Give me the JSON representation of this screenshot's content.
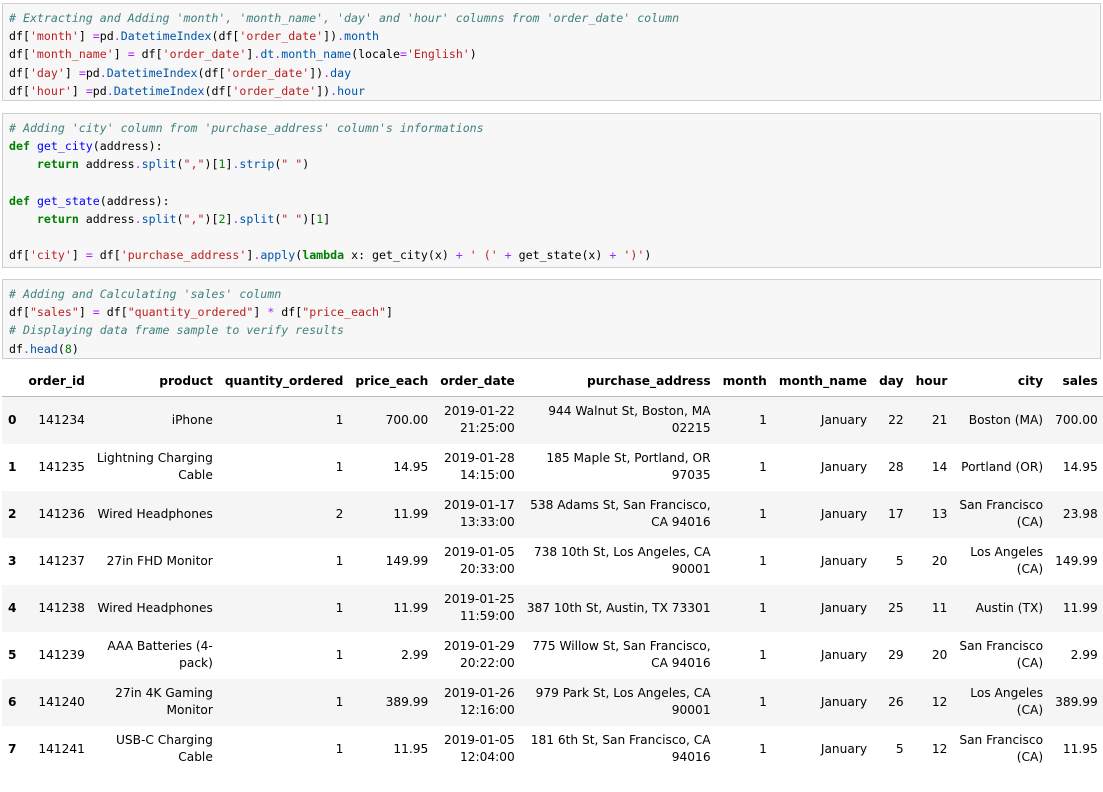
{
  "cells": [
    {
      "lines": [
        [
          [
            "cm",
            "# Extracting and Adding 'month', 'month_name', 'day' and 'hour' columns from 'order_date' column"
          ]
        ],
        [
          [
            "",
            "df["
          ],
          [
            "st",
            "'month'"
          ],
          [
            "",
            "] "
          ],
          [
            "op",
            "="
          ],
          [
            "",
            "pd"
          ],
          [
            "op",
            "."
          ],
          [
            "at",
            "DatetimeIndex"
          ],
          [
            "",
            "(df["
          ],
          [
            "st",
            "'order_date'"
          ],
          [
            "",
            "])"
          ],
          [
            "op",
            "."
          ],
          [
            "at",
            "month"
          ]
        ],
        [
          [
            "",
            "df["
          ],
          [
            "st",
            "'month_name'"
          ],
          [
            "",
            "] "
          ],
          [
            "op",
            "="
          ],
          [
            "",
            " df["
          ],
          [
            "st",
            "'order_date'"
          ],
          [
            "",
            "]"
          ],
          [
            "op",
            "."
          ],
          [
            "at",
            "dt"
          ],
          [
            "op",
            "."
          ],
          [
            "at",
            "month_name"
          ],
          [
            "",
            "(locale"
          ],
          [
            "op",
            "="
          ],
          [
            "st",
            "'English'"
          ],
          [
            "",
            ")"
          ]
        ],
        [
          [
            "",
            "df["
          ],
          [
            "st",
            "'day'"
          ],
          [
            "",
            "] "
          ],
          [
            "op",
            "="
          ],
          [
            "",
            "pd"
          ],
          [
            "op",
            "."
          ],
          [
            "at",
            "DatetimeIndex"
          ],
          [
            "",
            "(df["
          ],
          [
            "st",
            "'order_date'"
          ],
          [
            "",
            "])"
          ],
          [
            "op",
            "."
          ],
          [
            "at",
            "day"
          ]
        ],
        [
          [
            "",
            "df["
          ],
          [
            "st",
            "'hour'"
          ],
          [
            "",
            "] "
          ],
          [
            "op",
            "="
          ],
          [
            "",
            "pd"
          ],
          [
            "op",
            "."
          ],
          [
            "at",
            "DatetimeIndex"
          ],
          [
            "",
            "(df["
          ],
          [
            "st",
            "'order_date'"
          ],
          [
            "",
            "])"
          ],
          [
            "op",
            "."
          ],
          [
            "at",
            "hour"
          ]
        ]
      ]
    },
    {
      "lines": [
        [
          [
            "cm",
            "# Adding 'city' column from 'purchase_address' column's informations"
          ]
        ],
        [
          [
            "kw",
            "def"
          ],
          [
            "",
            " "
          ],
          [
            "fn",
            "get_city"
          ],
          [
            "",
            "(address):"
          ]
        ],
        [
          [
            "",
            "    "
          ],
          [
            "kw",
            "return"
          ],
          [
            "",
            " address"
          ],
          [
            "op",
            "."
          ],
          [
            "at",
            "split"
          ],
          [
            "",
            "("
          ],
          [
            "st",
            "\",\""
          ],
          [
            "",
            ")["
          ],
          [
            "nu",
            "1"
          ],
          [
            "",
            "]"
          ],
          [
            "op",
            "."
          ],
          [
            "at",
            "strip"
          ],
          [
            "",
            "("
          ],
          [
            "st",
            "\" \""
          ],
          [
            "",
            ")"
          ]
        ],
        [
          [
            "",
            ""
          ]
        ],
        [
          [
            "kw",
            "def"
          ],
          [
            "",
            " "
          ],
          [
            "fn",
            "get_state"
          ],
          [
            "",
            "(address):"
          ]
        ],
        [
          [
            "",
            "    "
          ],
          [
            "kw",
            "return"
          ],
          [
            "",
            " address"
          ],
          [
            "op",
            "."
          ],
          [
            "at",
            "split"
          ],
          [
            "",
            "("
          ],
          [
            "st",
            "\",\""
          ],
          [
            "",
            ")["
          ],
          [
            "nu",
            "2"
          ],
          [
            "",
            "]"
          ],
          [
            "op",
            "."
          ],
          [
            "at",
            "split"
          ],
          [
            "",
            "("
          ],
          [
            "st",
            "\" \""
          ],
          [
            "",
            ")["
          ],
          [
            "nu",
            "1"
          ],
          [
            "",
            "]"
          ]
        ],
        [
          [
            "",
            ""
          ]
        ],
        [
          [
            "",
            "df["
          ],
          [
            "st",
            "'city'"
          ],
          [
            "",
            "] "
          ],
          [
            "op",
            "="
          ],
          [
            "",
            " df["
          ],
          [
            "st",
            "'purchase_address'"
          ],
          [
            "",
            "]"
          ],
          [
            "op",
            "."
          ],
          [
            "at",
            "apply"
          ],
          [
            "",
            "("
          ],
          [
            "kw",
            "lambda"
          ],
          [
            "",
            " x: get_city(x) "
          ],
          [
            "op",
            "+"
          ],
          [
            "",
            " "
          ],
          [
            "st",
            "' ('"
          ],
          [
            "",
            " "
          ],
          [
            "op",
            "+"
          ],
          [
            "",
            " get_state(x) "
          ],
          [
            "op",
            "+"
          ],
          [
            "",
            " "
          ],
          [
            "st",
            "')'"
          ],
          [
            "",
            ")"
          ]
        ]
      ]
    },
    {
      "lines": [
        [
          [
            "cm",
            "# Adding and Calculating 'sales' column"
          ]
        ],
        [
          [
            "",
            "df["
          ],
          [
            "st",
            "\"sales\""
          ],
          [
            "",
            "] "
          ],
          [
            "op",
            "="
          ],
          [
            "",
            " df["
          ],
          [
            "st",
            "\"quantity_ordered\""
          ],
          [
            "",
            "] "
          ],
          [
            "op",
            "*"
          ],
          [
            "",
            " df["
          ],
          [
            "st",
            "\"price_each\""
          ],
          [
            "",
            "]"
          ]
        ],
        [
          [
            "cm",
            "# Displaying data frame sample to verify results"
          ]
        ],
        [
          [
            "",
            "df"
          ],
          [
            "op",
            "."
          ],
          [
            "at",
            "head"
          ],
          [
            "",
            "("
          ],
          [
            "nu",
            "8"
          ],
          [
            "",
            ")"
          ]
        ]
      ]
    }
  ],
  "table": {
    "columns": [
      "",
      "order_id",
      "product",
      "quantity_ordered",
      "price_each",
      "order_date",
      "purchase_address",
      "month",
      "month_name",
      "day",
      "hour",
      "city",
      "sales"
    ],
    "rows": [
      {
        "index": "0",
        "cells": [
          "141234",
          "iPhone",
          "1",
          "700.00",
          [
            "2019-01-22",
            "21:25:00"
          ],
          [
            "944 Walnut St, Boston, MA",
            "02215"
          ],
          "1",
          "January",
          "22",
          "21",
          "Boston (MA)",
          "700.00"
        ]
      },
      {
        "index": "1",
        "cells": [
          "141235",
          [
            "Lightning Charging",
            "Cable"
          ],
          "1",
          "14.95",
          [
            "2019-01-28",
            "14:15:00"
          ],
          [
            "185 Maple St, Portland, OR",
            "97035"
          ],
          "1",
          "January",
          "28",
          "14",
          "Portland (OR)",
          "14.95"
        ]
      },
      {
        "index": "2",
        "cells": [
          "141236",
          "Wired Headphones",
          "2",
          "11.99",
          [
            "2019-01-17",
            "13:33:00"
          ],
          [
            "538 Adams St, San Francisco,",
            "CA 94016"
          ],
          "1",
          "January",
          "17",
          "13",
          [
            "San Francisco",
            "(CA)"
          ],
          "23.98"
        ]
      },
      {
        "index": "3",
        "cells": [
          "141237",
          "27in FHD Monitor",
          "1",
          "149.99",
          [
            "2019-01-05",
            "20:33:00"
          ],
          [
            "738 10th St, Los Angeles, CA",
            "90001"
          ],
          "1",
          "January",
          "5",
          "20",
          [
            "Los Angeles",
            "(CA)"
          ],
          "149.99"
        ]
      },
      {
        "index": "4",
        "cells": [
          "141238",
          "Wired Headphones",
          "1",
          "11.99",
          [
            "2019-01-25",
            "11:59:00"
          ],
          "387 10th St, Austin, TX 73301",
          "1",
          "January",
          "25",
          "11",
          "Austin (TX)",
          "11.99"
        ]
      },
      {
        "index": "5",
        "cells": [
          "141239",
          [
            "AAA Batteries (4-",
            "pack)"
          ],
          "1",
          "2.99",
          [
            "2019-01-29",
            "20:22:00"
          ],
          [
            "775 Willow St, San Francisco,",
            "CA 94016"
          ],
          "1",
          "January",
          "29",
          "20",
          [
            "San Francisco",
            "(CA)"
          ],
          "2.99"
        ]
      },
      {
        "index": "6",
        "cells": [
          "141240",
          [
            "27in 4K Gaming",
            "Monitor"
          ],
          "1",
          "389.99",
          [
            "2019-01-26",
            "12:16:00"
          ],
          [
            "979 Park St, Los Angeles, CA",
            "90001"
          ],
          "1",
          "January",
          "26",
          "12",
          [
            "Los Angeles",
            "(CA)"
          ],
          "389.99"
        ]
      },
      {
        "index": "7",
        "cells": [
          "141241",
          [
            "USB-C Charging",
            "Cable"
          ],
          "1",
          "11.95",
          [
            "2019-01-05",
            "12:04:00"
          ],
          [
            "181 6th St, San Francisco, CA",
            "94016"
          ],
          "1",
          "January",
          "5",
          "12",
          [
            "San Francisco",
            "(CA)"
          ],
          "11.95"
        ]
      }
    ]
  }
}
